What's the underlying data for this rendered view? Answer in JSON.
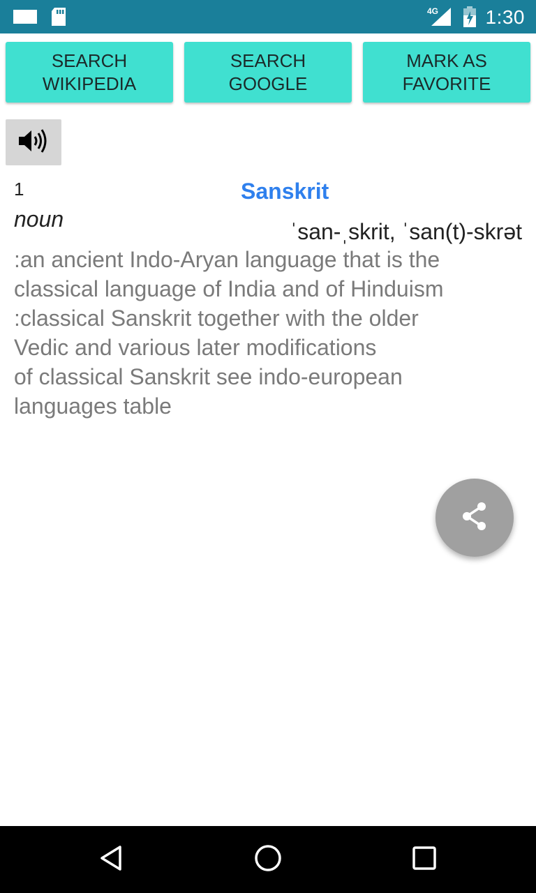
{
  "status_bar": {
    "time": "1:30",
    "network_label": "4G",
    "icons": [
      "notification-icon",
      "sd-card-icon",
      "signal-icon",
      "battery-icon"
    ]
  },
  "toolbar": {
    "buttons": [
      {
        "label": "SEARCH\nWIKIPEDIA"
      },
      {
        "label": "SEARCH\nGOOGLE"
      },
      {
        "label": "MARK AS\nFAVORITE"
      }
    ],
    "button_color": "#40e0d0"
  },
  "speaker": {
    "icon": "speaker-icon"
  },
  "entry": {
    "sense_number": "1",
    "headword": "Sanskrit",
    "headword_color": "#2f80ed",
    "part_of_speech": "noun",
    "pronunciation": "ˈsan-ˌskrit, ˈsan(t)-skrət",
    "definition_lines": [
      ":an ancient Indo-Aryan language that is the",
      "classical language of India and of Hinduism",
      ":classical Sanskrit together with the older",
      "Vedic and various later modifications",
      "of classical Sanskrit see indo-european",
      "languages table"
    ]
  },
  "fab": {
    "icon": "share-icon",
    "color": "#a0a0a0"
  },
  "nav_bar": {
    "icons": [
      "back-icon",
      "home-icon",
      "recents-icon"
    ]
  }
}
